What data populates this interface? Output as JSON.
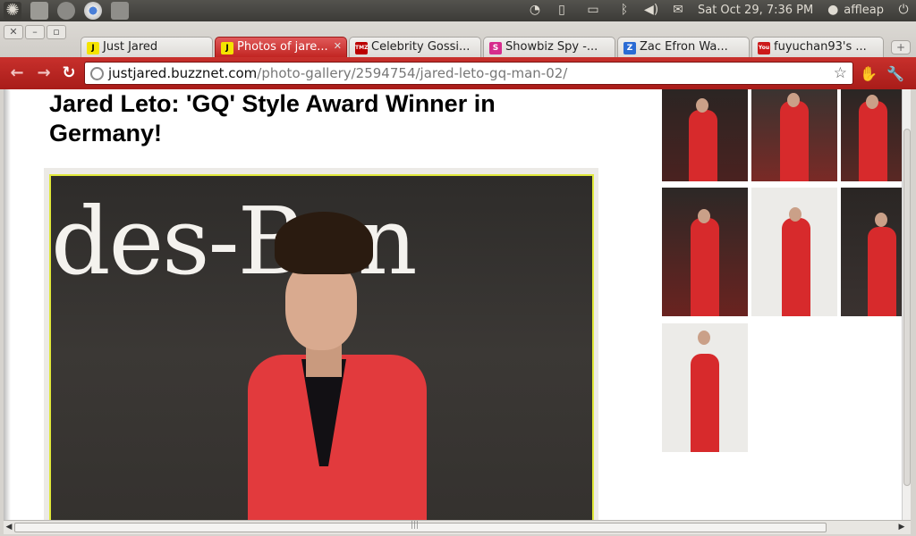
{
  "panel": {
    "datetime": "Sat Oct 29,  7:36 PM",
    "user": "affleap",
    "icons": [
      "ubuntu-logo-icon",
      "text-editor-icon",
      "browser-icon",
      "chrome-icon",
      "images-icon",
      "wifi-icon",
      "battery-indicator-icon",
      "battery-icon",
      "bluetooth-icon",
      "volume-icon",
      "mail-icon",
      "user-icon",
      "power-icon"
    ]
  },
  "browser": {
    "tabs": [
      {
        "label": "Just Jared",
        "favicon": "J",
        "favicon_bg": "#f4e400",
        "favicon_fg": "#000"
      },
      {
        "label": "Photos of jare...",
        "favicon": "J",
        "favicon_bg": "#f4e400",
        "favicon_fg": "#000",
        "active": true
      },
      {
        "label": "Celebrity Gossi...",
        "favicon": "TMZ",
        "favicon_bg": "#b00",
        "favicon_fg": "#fff"
      },
      {
        "label": "Showbiz Spy -...",
        "favicon": "S",
        "favicon_bg": "#d62c8c",
        "favicon_fg": "#fff"
      },
      {
        "label": "Zac Efron Wa...",
        "favicon": "Z",
        "favicon_bg": "#2a6bd4",
        "favicon_fg": "#fff"
      },
      {
        "label": "fuyuchan93's ...",
        "favicon": "You",
        "favicon_bg": "#cc1a1a",
        "favicon_fg": "#fff"
      }
    ],
    "url_domain": "justjared.buzznet.com",
    "url_path": "/photo-gallery/2594754/jared-leto-gq-man-02/"
  },
  "page": {
    "title": "Jared Leto: 'GQ' Style Award Winner in Germany!",
    "photo_backdrop_text": "des-Ben",
    "accent_red": "#c8302c"
  }
}
